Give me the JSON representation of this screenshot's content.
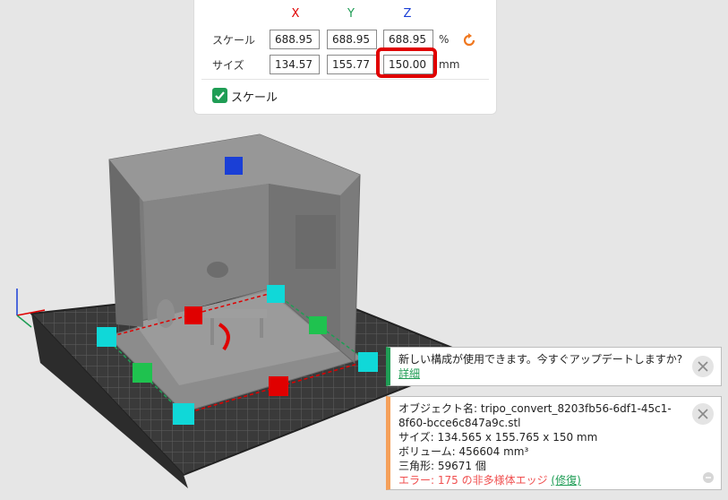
{
  "scale_panel": {
    "axis_x": "X",
    "axis_y": "Y",
    "axis_z": "Z",
    "scale_label": "スケール",
    "size_label": "サイズ",
    "scale_x": "688.95",
    "scale_y": "688.95",
    "scale_z": "688.95",
    "scale_unit": "%",
    "size_x": "134.57",
    "size_y": "155.77",
    "size_z": "150.00",
    "size_unit": "mm",
    "uniform_scale_label": "スケール",
    "uniform_scale_checked": true
  },
  "notifications": {
    "update": {
      "message": "新しい構成が使用できます。今すぐアップデートしますか?",
      "link": "詳細"
    },
    "object_info": {
      "name_line": "オブジェクト名: tripo_convert_8203fb56-6df1-45c1-8f60-bcce6c847a9c.stl",
      "size_line": "サイズ: 134.565 x 155.765 x 150 mm",
      "volume_line": "ボリューム: 456604 mm³",
      "triangles_line": "三角形: 59671 個",
      "error_text": "エラー: 175 の非多様体エッジ",
      "repair_link": "(修復)"
    }
  },
  "colors": {
    "x_axis": "#e00000",
    "y_axis": "#1f9d55",
    "z_axis": "#1a3fd6",
    "highlight": "#e00000",
    "accent": "#1f9d55",
    "warning_accent": "#f5a05a",
    "error_text": "#f05050",
    "reset_icon": "#f07820"
  },
  "icons": [
    "reset-icon",
    "checkbox-checked-icon",
    "close-icon",
    "minimize-icon"
  ]
}
